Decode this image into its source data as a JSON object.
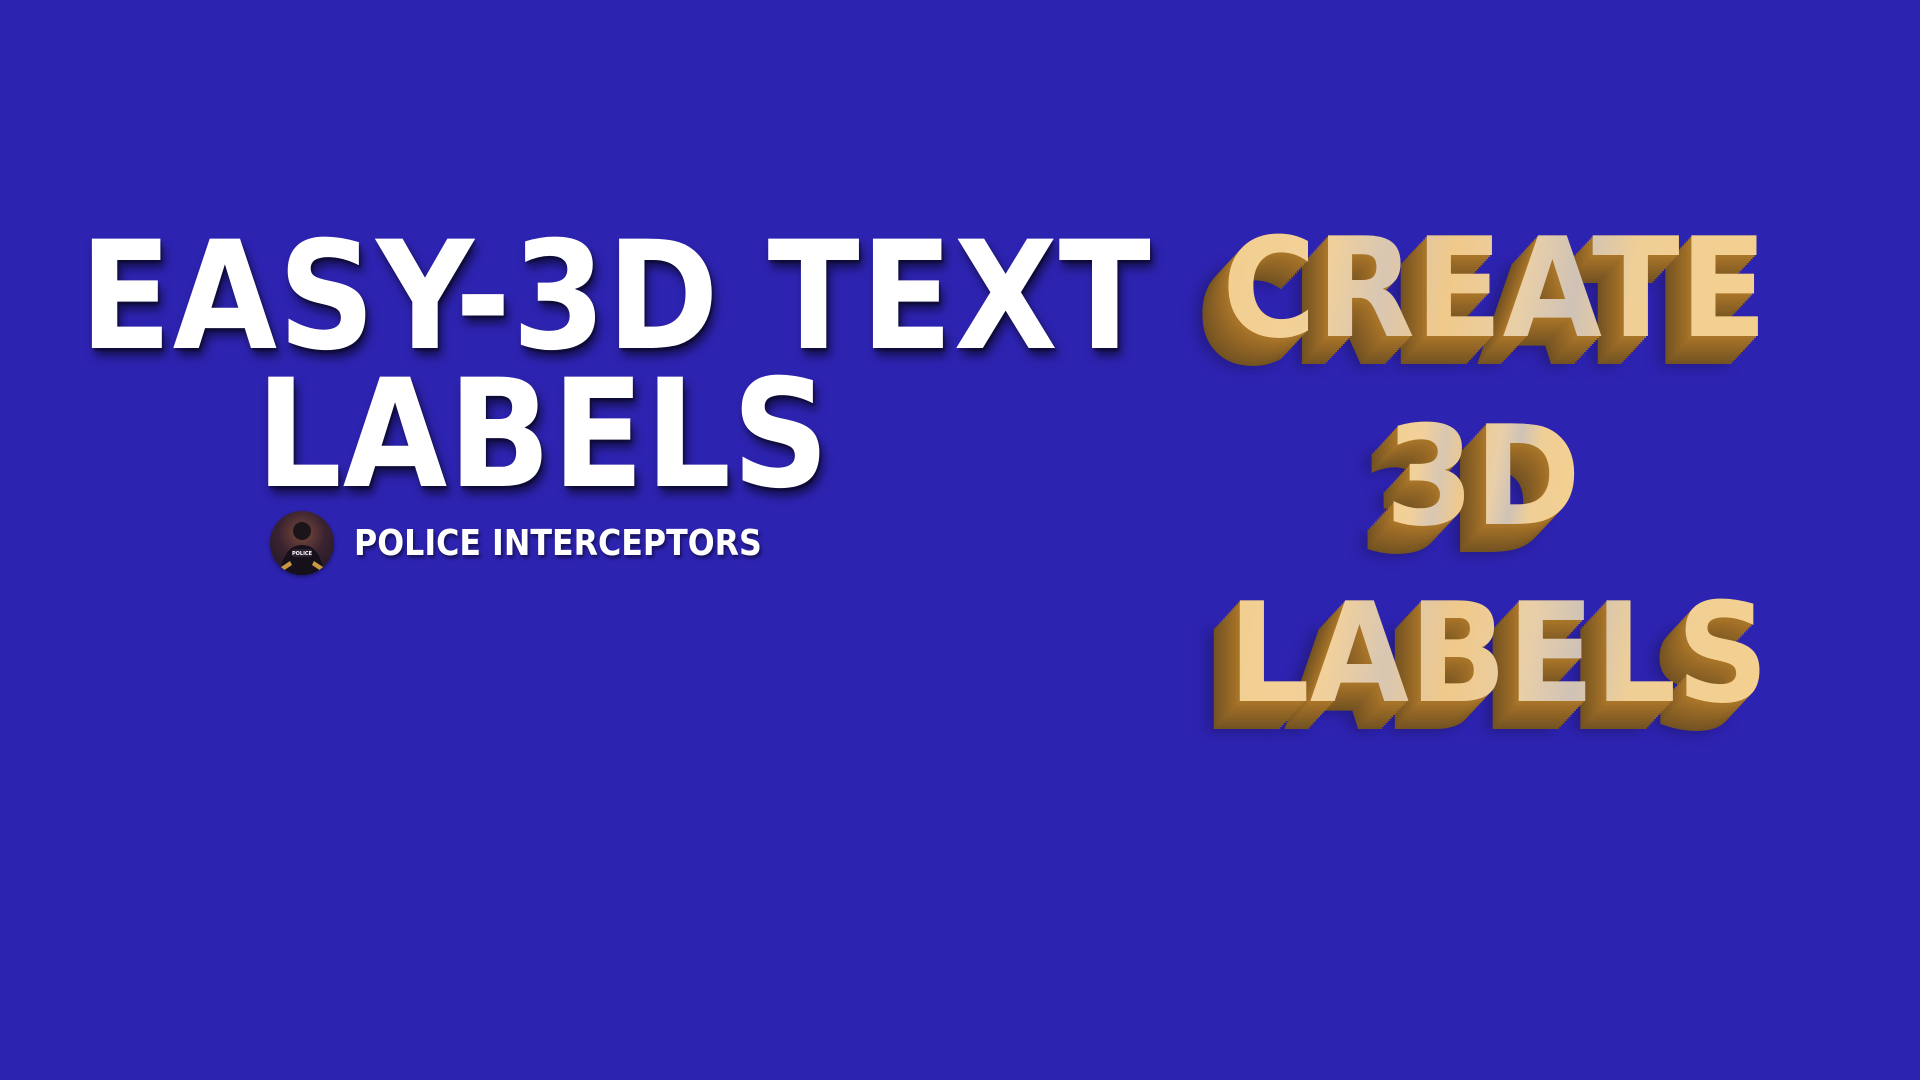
{
  "title": {
    "line1": "EASY-3D TEXT",
    "line2": "LABELS"
  },
  "channel": {
    "name": "POLICE INTERCEPTORS",
    "avatar_text": "POLICE"
  },
  "feature_text": {
    "line1": "CREATE",
    "line2": "3D",
    "line3": "LABELS"
  },
  "colors": {
    "background": "#2d23b1",
    "title_text": "#ffffff",
    "gold_face": "#f1cf93",
    "gold_extrude": "#a9772a"
  }
}
